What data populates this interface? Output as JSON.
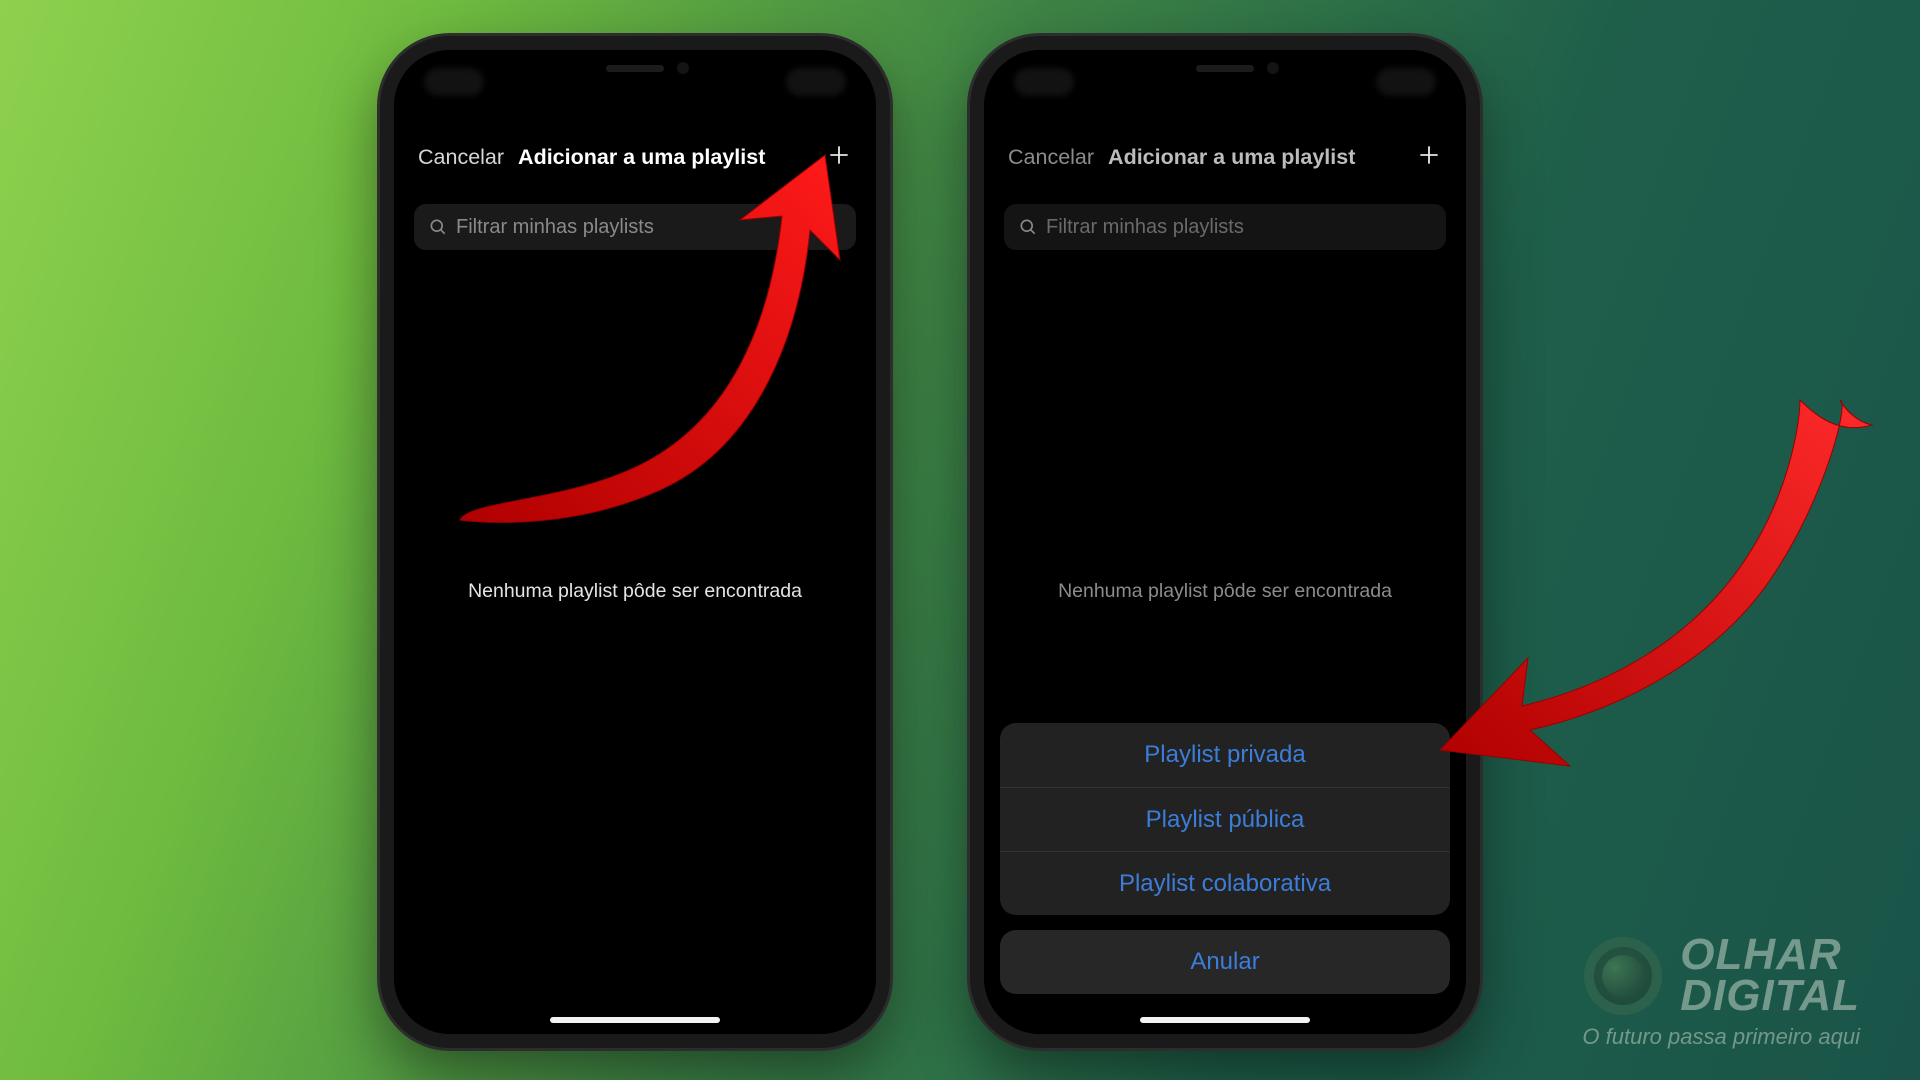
{
  "screen": {
    "cancel": "Cancelar",
    "title": "Adicionar a uma playlist",
    "search_placeholder": "Filtrar minhas playlists",
    "empty": "Nenhuma playlist pôde ser encontrada"
  },
  "sheet": {
    "options": [
      "Playlist privada",
      "Playlist pública",
      "Playlist colaborativa"
    ],
    "cancel": "Anular"
  },
  "watermark": {
    "name1": "OLHAR",
    "name2": "DIGITAL",
    "tagline": "O futuro passa primeiro aqui"
  }
}
